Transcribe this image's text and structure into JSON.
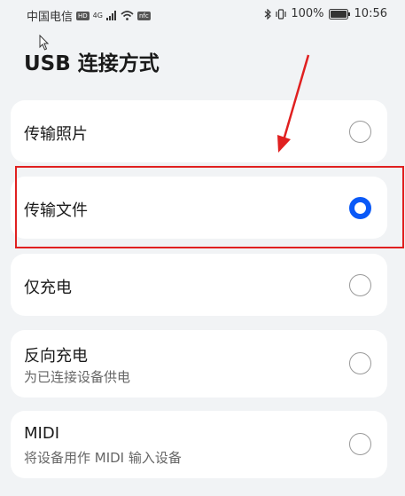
{
  "status_bar": {
    "carrier": "中国电信",
    "hd_badge": "HD",
    "network": "4G",
    "nfc_badge": "nfc",
    "battery_pct": "100%",
    "time": "10:56"
  },
  "page": {
    "title": "USB 连接方式"
  },
  "options": [
    {
      "label": "传输照片",
      "sublabel": "",
      "selected": false
    },
    {
      "label": "传输文件",
      "sublabel": "",
      "selected": true
    },
    {
      "label": "仅充电",
      "sublabel": "",
      "selected": false
    },
    {
      "label": "反向充电",
      "sublabel": "为已连接设备供电",
      "selected": false
    },
    {
      "label": "MIDI",
      "sublabel": "将设备用作 MIDI 输入设备",
      "selected": false
    }
  ],
  "colors": {
    "accent": "#0a59f7",
    "annotation": "#e02020",
    "background": "#f1f3f5"
  }
}
